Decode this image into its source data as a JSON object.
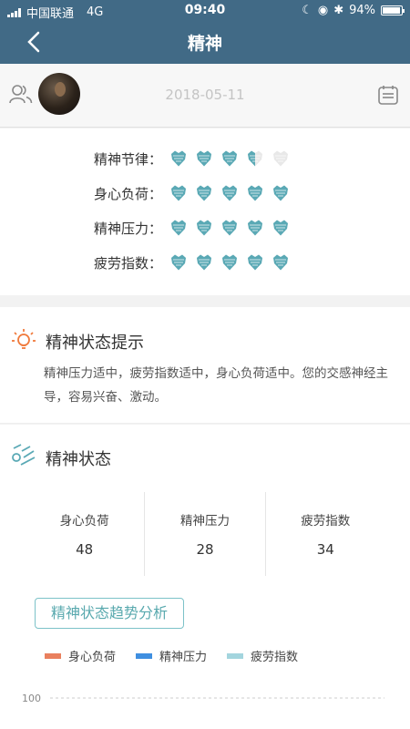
{
  "status_bar": {
    "carrier": "中国联通",
    "network": "4G",
    "time": "09:40",
    "battery": "94%"
  },
  "nav": {
    "title": "精神"
  },
  "user_row": {
    "date": "2018-05-11"
  },
  "ratings": [
    {
      "label": "精神节律：",
      "value": 3.5,
      "max": 5
    },
    {
      "label": "身心负荷：",
      "value": 5,
      "max": 5
    },
    {
      "label": "精神压力：",
      "value": 5,
      "max": 5
    },
    {
      "label": "疲劳指数：",
      "value": 5,
      "max": 5
    }
  ],
  "tips": {
    "title": "精神状态提示",
    "text": "精神压力适中，疲劳指数适中，身心负荷适中。您的交感神经主导，容易兴奋、激动。"
  },
  "state": {
    "title": "精神状态",
    "stats": [
      {
        "label": "身心负荷",
        "value": "48"
      },
      {
        "label": "精神压力",
        "value": "28"
      },
      {
        "label": "疲劳指数",
        "value": "34"
      }
    ],
    "trend_button": "精神状态趋势分析",
    "legend": [
      {
        "label": "身心负荷",
        "color": "#e9805e"
      },
      {
        "label": "精神压力",
        "color": "#3f8fe0"
      },
      {
        "label": "疲劳指数",
        "color": "#a3d5de"
      }
    ]
  },
  "colors": {
    "header": "#416a86",
    "heart_fill": "#5aa9b5",
    "heart_empty": "#e8e8e8",
    "accent": "#59a9ae",
    "tip_icon": "#f07a3c"
  },
  "chart_data": {
    "type": "line",
    "yticks": [
      100
    ],
    "ylim_top": 100,
    "series": [
      {
        "name": "身心负荷",
        "values": []
      },
      {
        "name": "精神压力",
        "values": []
      },
      {
        "name": "疲劳指数",
        "values": []
      }
    ],
    "grid": "dashed"
  }
}
